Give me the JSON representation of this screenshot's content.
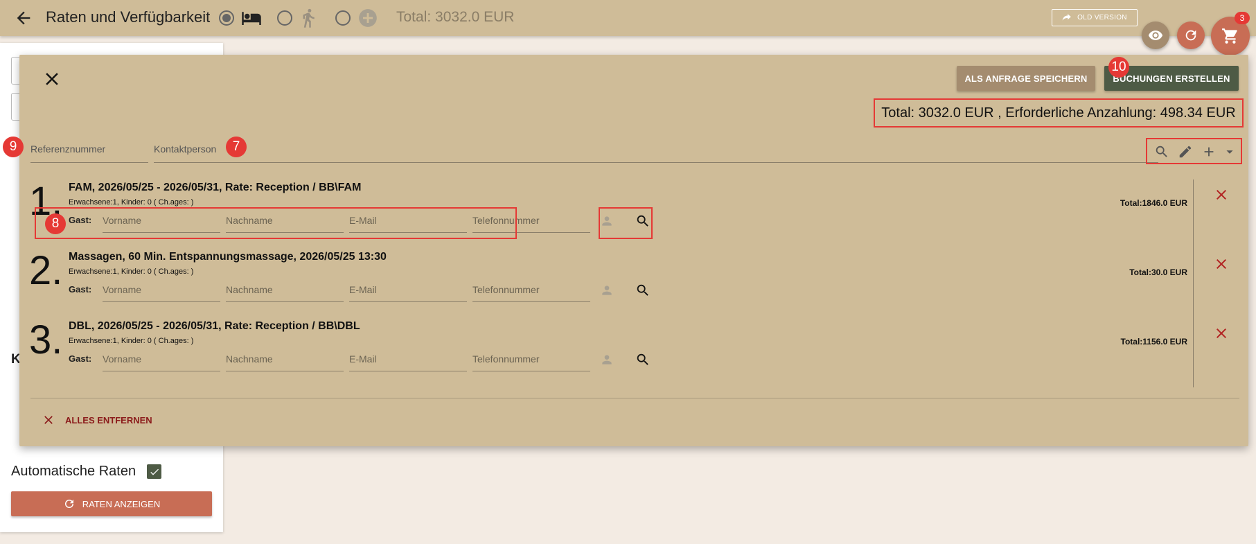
{
  "header": {
    "title": "Raten und Verfügbarkeit",
    "total": "Total: 3032.0 EUR",
    "old_version": "OLD VERSION",
    "cart_count": "3"
  },
  "sidebar": {
    "k_label": "K",
    "auto_rates": "Automatische Raten",
    "show_rates": "RATEN ANZEIGEN"
  },
  "cart": {
    "save_request": "ALS ANFRAGE SPEICHERN",
    "create_bookings": "BUCHUNGEN ERSTELLEN",
    "summary": "Total: 3032.0 EUR , Erforderliche Anzahlung: 498.34 EUR",
    "reference_placeholder": "Referenznummer",
    "contact_placeholder": "Kontaktperson",
    "guest_label": "Gast:",
    "guest_fields": [
      "Vorname",
      "Nachname",
      "E-Mail",
      "Telefonnummer"
    ],
    "items": [
      {
        "number": "1.",
        "title": "FAM, 2026/05/25 - 2026/05/31, Rate: Reception / BB\\FAM",
        "sub": "Erwachsene:1, Kinder: 0 ( Ch.ages: )",
        "total": "Total:1846.0 EUR"
      },
      {
        "number": "2.",
        "title": "Massagen, 60 Min. Entspannungsmassage, 2026/05/25 13:30",
        "sub": "Erwachsene:1, Kinder: 0 ( Ch.ages: )",
        "total": "Total:30.0 EUR"
      },
      {
        "number": "3.",
        "title": "DBL, 2026/05/25 - 2026/05/31, Rate: Reception / BB\\DBL",
        "sub": "Erwachsene:1, Kinder: 0 ( Ch.ages: )",
        "total": "Total:1156.0 EUR"
      }
    ],
    "remove_all": "ALLES ENTFERNEN"
  },
  "markers": {
    "m7": "7",
    "m8": "8",
    "m9": "9",
    "m10": "10"
  },
  "colors": {
    "bar": "#cfbc98",
    "accent_red": "#c86d55",
    "dark_green": "#4e5b45",
    "annotation_red": "#e53935"
  }
}
